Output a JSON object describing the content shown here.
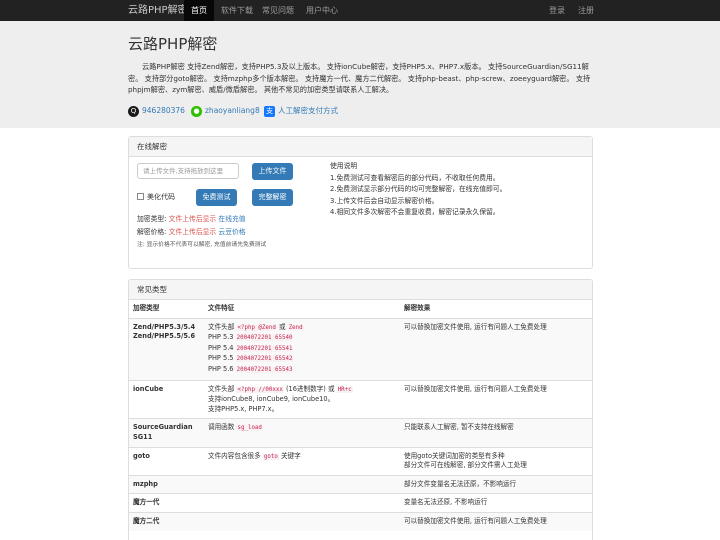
{
  "nav": {
    "brand": "云路PHP解密",
    "items": [
      "首页",
      "软件下载",
      "常见问题",
      "用户中心"
    ],
    "login": "登录",
    "register": "注册"
  },
  "header": {
    "title": "云路PHP解密",
    "intro": "云路PHP解密 支持Zend解密，支持PHP5.3及以上版本。 支持ionCube解密，支持PHP5.x、PHP7.x版本。 支持SourceGuardian/SG11解密。 支持部分goto解密。 支持mzphp多个版本解密。 支持魔方一代、魔方二代解密。 支持php-beast、php-screw、zoeeyguard解密。 支持phpjm解密、zym解密、威盾/微盾解密。 其他不常见的加密类型请联系人工解决。",
    "qq": "946280376",
    "wechat": "zhaoyanliang8",
    "pay_link": "人工解密支付方式"
  },
  "online": {
    "heading": "在线解密",
    "upload_placeholder": "请上传文件,支持拖放到这里",
    "upload_btn": "上传文件",
    "beautify": "美化代码",
    "free_btn": "免费测试",
    "full_btn": "完整解密",
    "enc_type_label": "加密类型:",
    "enc_type_value": "文件上传后显示",
    "recharge": "在线充值",
    "price_label": "解密价格:",
    "price_value": "文件上传后显示",
    "bean_price": "云豆价格",
    "note": "注: 显示价格不代表可以解密, 充值前请先免费测试",
    "usage_title": "使用说明",
    "usage": [
      "1.免费测试可查看解密后的部分代码，不收取任何费用。",
      "2.免费测试显示部分代码的均可完整解密，在线充值即可。",
      "3.上传文件后会自动显示解密价格。",
      "4.相同文件多次解密不会重复收费，解密记录永久保留。"
    ]
  },
  "faq": {
    "heading": "常见类型",
    "columns": [
      "加密类型",
      "文件特征",
      "解密效果"
    ],
    "rows": {
      "zend": {
        "type": "Zend/PHP5.3/5.4 Zend/PHP5.5/5.6",
        "feat_pre": "文件头部",
        "code1": "<?php @Zend",
        "or": "或",
        "code2": "Zend",
        "versions": [
          {
            "v": "PHP 5.3",
            "c": "2004072201 65540"
          },
          {
            "v": "PHP 5.4",
            "c": "2004072201 65541"
          },
          {
            "v": "PHP 5.5",
            "c": "2004072201 65542"
          },
          {
            "v": "PHP 5.6",
            "c": "2004072201 65543"
          }
        ],
        "effect": "可以替换加密文件使用, 运行有问题人工免费处理"
      },
      "ioncube": {
        "type": "ionCube",
        "feat_pre": "文件头部",
        "code1": "<?php //00xxx",
        "mid": "(16进制数字) 或",
        "code2": "HR+c",
        "line2": "支持ionCube8, ionCube9, ionCube10。",
        "line3": "支持PHP5.x, PHP7.x。",
        "effect": "可以替换加密文件使用, 运行有问题人工免费处理"
      },
      "sg": {
        "type": "SourceGuardian SG11",
        "feat_pre": "调用函数",
        "code1": "sg_load",
        "effect": "只能联系人工解密, 暂不支持在线解密"
      },
      "goto": {
        "type": "goto",
        "feat_pre": "文件内容包含很多",
        "code1": "goto",
        "feat_post": "关键字",
        "effect1": "使用goto关键词加密的类型有多种",
        "effect2": "部分文件可在线解密, 部分文件需人工处理"
      },
      "mzphp": {
        "type": "mzphp",
        "effect": "部分文件变量名无法还原，不影响运行"
      },
      "mf1": {
        "type": "魔方一代",
        "effect": "变量名无法还原, 不影响运行"
      },
      "mf2": {
        "type": "魔方二代",
        "effect": "可以替换加密文件使用, 运行有问题人工免费处理"
      }
    }
  }
}
